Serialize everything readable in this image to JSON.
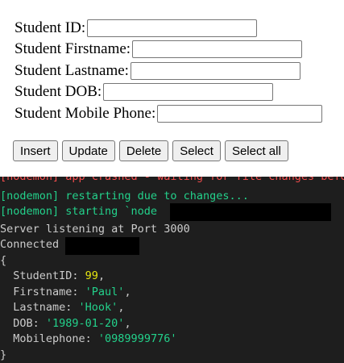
{
  "form": {
    "fields": [
      {
        "label": "Student ID:",
        "value": ""
      },
      {
        "label": "Student Firstname:",
        "value": ""
      },
      {
        "label": "Student Lastname:",
        "value": ""
      },
      {
        "label": "Student DOB:",
        "value": ""
      },
      {
        "label": "Student Mobile Phone:",
        "value": ""
      }
    ],
    "buttons": [
      "Insert",
      "Update",
      "Delete",
      "Select",
      "Select all"
    ]
  },
  "terminal": {
    "partial_top": "[nodemon] app crashed - waiting for file changes before starting...",
    "restart": "[nodemon] restarting due to changes...",
    "starting": "[nodemon] starting `node",
    "listening": "Server listening at Port 3000",
    "connected": "Connected",
    "open_brace": "{",
    "close_brace": "}",
    "record": {
      "id_key": "  StudentID: ",
      "id_val": "99",
      "first_key": "  Firstname: ",
      "first_val": "'Paul'",
      "last_key": "  Lastname: ",
      "last_val": "'Hook'",
      "dob_key": "  DOB: ",
      "dob_val": "'1989-01-20'",
      "phone_key": "  Mobilephone: ",
      "phone_val": "'0989999776'",
      "comma": ","
    },
    "colors": {
      "background": "#1e1e1e",
      "green": "#23d18b",
      "yellow": "#e5e510",
      "red": "#f14c4c"
    }
  }
}
